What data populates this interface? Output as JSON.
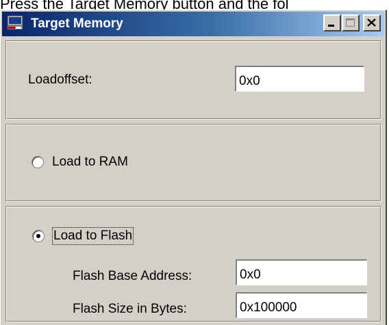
{
  "caption": "Press the Target Memory button and the fol",
  "window": {
    "title": "Target Memory",
    "controls": {
      "minimize_icon": "minimize-icon",
      "maximize_icon": "maximize-icon",
      "close_icon": "close-icon"
    }
  },
  "loadoffset": {
    "label": "Loadoffset:",
    "value": "0x0"
  },
  "load_ram": {
    "label": "Load to RAM",
    "selected": false
  },
  "load_flash": {
    "label": "Load to Flash",
    "selected": true,
    "base_address": {
      "label": "Flash Base Address:",
      "value": "0x0"
    },
    "size": {
      "label": "Flash Size in Bytes:",
      "value": "0x100000"
    }
  }
}
